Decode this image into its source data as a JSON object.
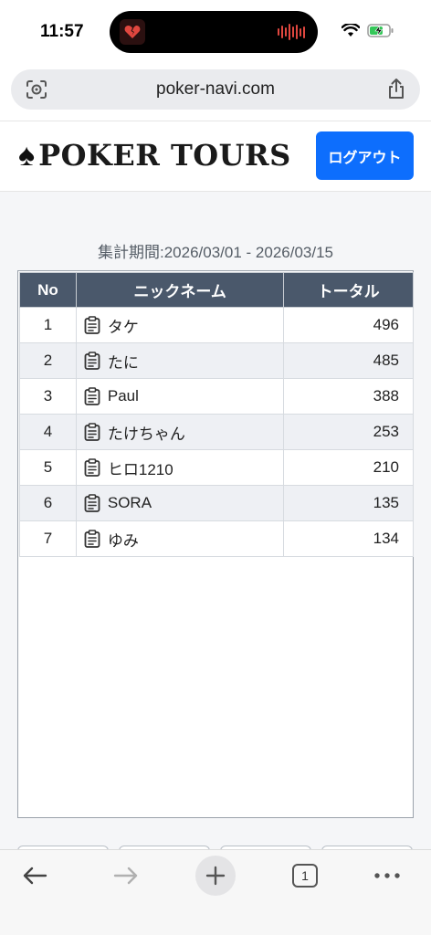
{
  "status": {
    "time": "11:57"
  },
  "browser": {
    "url": "poker-navi.com",
    "tab_count": "1"
  },
  "header": {
    "logo_spade": "♠",
    "logo_text": "POKER TOURS",
    "logout_label": "ログアウト"
  },
  "ranking": {
    "period": "集計期間:2026/03/01 - 2026/03/15",
    "columns": {
      "no": "No",
      "name": "ニックネーム",
      "total": "トータル"
    },
    "rows": [
      {
        "no": "1",
        "name": "タケ",
        "total": "496"
      },
      {
        "no": "2",
        "name": "たに",
        "total": "485"
      },
      {
        "no": "3",
        "name": "Paul",
        "total": "388"
      },
      {
        "no": "4",
        "name": "たけちゃん",
        "total": "253"
      },
      {
        "no": "5",
        "name": "ヒロ1210",
        "total": "210"
      },
      {
        "no": "6",
        "name": "SORA",
        "total": "135"
      },
      {
        "no": "7",
        "name": "ゆみ",
        "total": "134"
      }
    ]
  },
  "colors": {
    "primary": "#0d6efd",
    "table_header": "#4a586b",
    "row_stripe": "#eef0f4"
  }
}
